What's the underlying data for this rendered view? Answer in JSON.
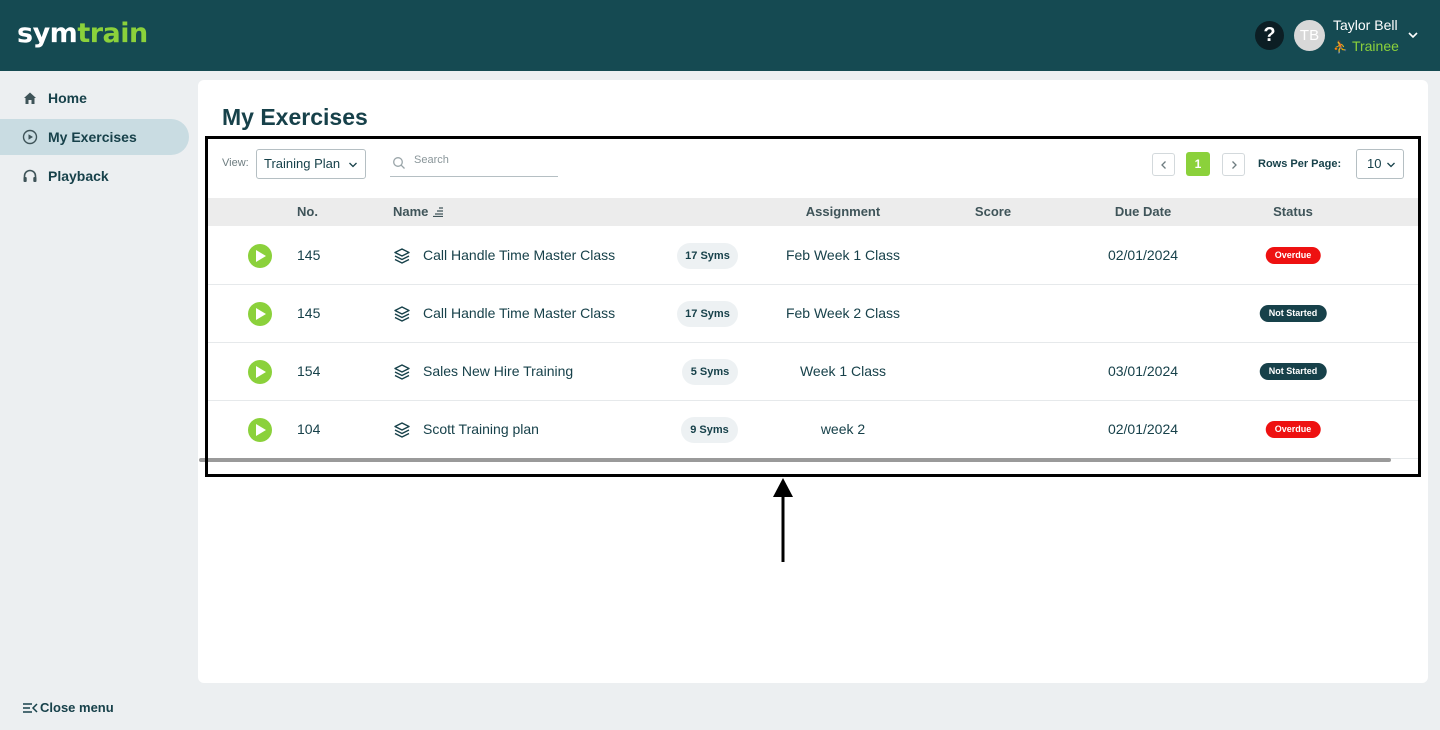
{
  "app": {
    "logo_main": "sym",
    "logo_accent": "train"
  },
  "header": {
    "help_label": "?",
    "avatar_initials": "TB",
    "user_name": "Taylor Bell",
    "user_role": "Trainee"
  },
  "sidebar": {
    "items": [
      {
        "label": "Home",
        "icon": "home-icon"
      },
      {
        "label": "My Exercises",
        "icon": "play-circle-icon"
      },
      {
        "label": "Playback",
        "icon": "headphones-icon"
      }
    ],
    "close_menu_label": "Close menu"
  },
  "page": {
    "title": "My Exercises"
  },
  "toolbar": {
    "view_label": "View:",
    "view_value": "Training Plan",
    "search_placeholder": "Search",
    "current_page": "1",
    "rows_per_page_label": "Rows Per Page:",
    "rows_per_page_value": "10"
  },
  "table": {
    "headers": {
      "no": "No.",
      "name": "Name",
      "assignment": "Assignment",
      "score": "Score",
      "due_date": "Due Date",
      "status": "Status"
    },
    "rows": [
      {
        "no": "145",
        "name": "Call Handle Time Master Class",
        "syms": "17 Syms",
        "assignment": "Feb Week 1 Class",
        "score": "",
        "due_date": "02/01/2024",
        "status": "Overdue"
      },
      {
        "no": "145",
        "name": "Call Handle Time Master Class",
        "syms": "17 Syms",
        "assignment": "Feb Week 2 Class",
        "score": "",
        "due_date": "",
        "status": "Not Started"
      },
      {
        "no": "154",
        "name": "Sales New Hire Training",
        "syms": "5 Syms",
        "assignment": "Week 1 Class",
        "score": "",
        "due_date": "03/01/2024",
        "status": "Not Started"
      },
      {
        "no": "104",
        "name": "Scott Training plan",
        "syms": "9 Syms",
        "assignment": "week 2",
        "score": "",
        "due_date": "02/01/2024",
        "status": "Overdue"
      }
    ]
  },
  "colors": {
    "header_bg": "#154a52",
    "brand_green": "#8bd13b",
    "text_dark": "#17414a",
    "overdue_red": "#ee1111",
    "not_started_bg": "#17414a"
  }
}
